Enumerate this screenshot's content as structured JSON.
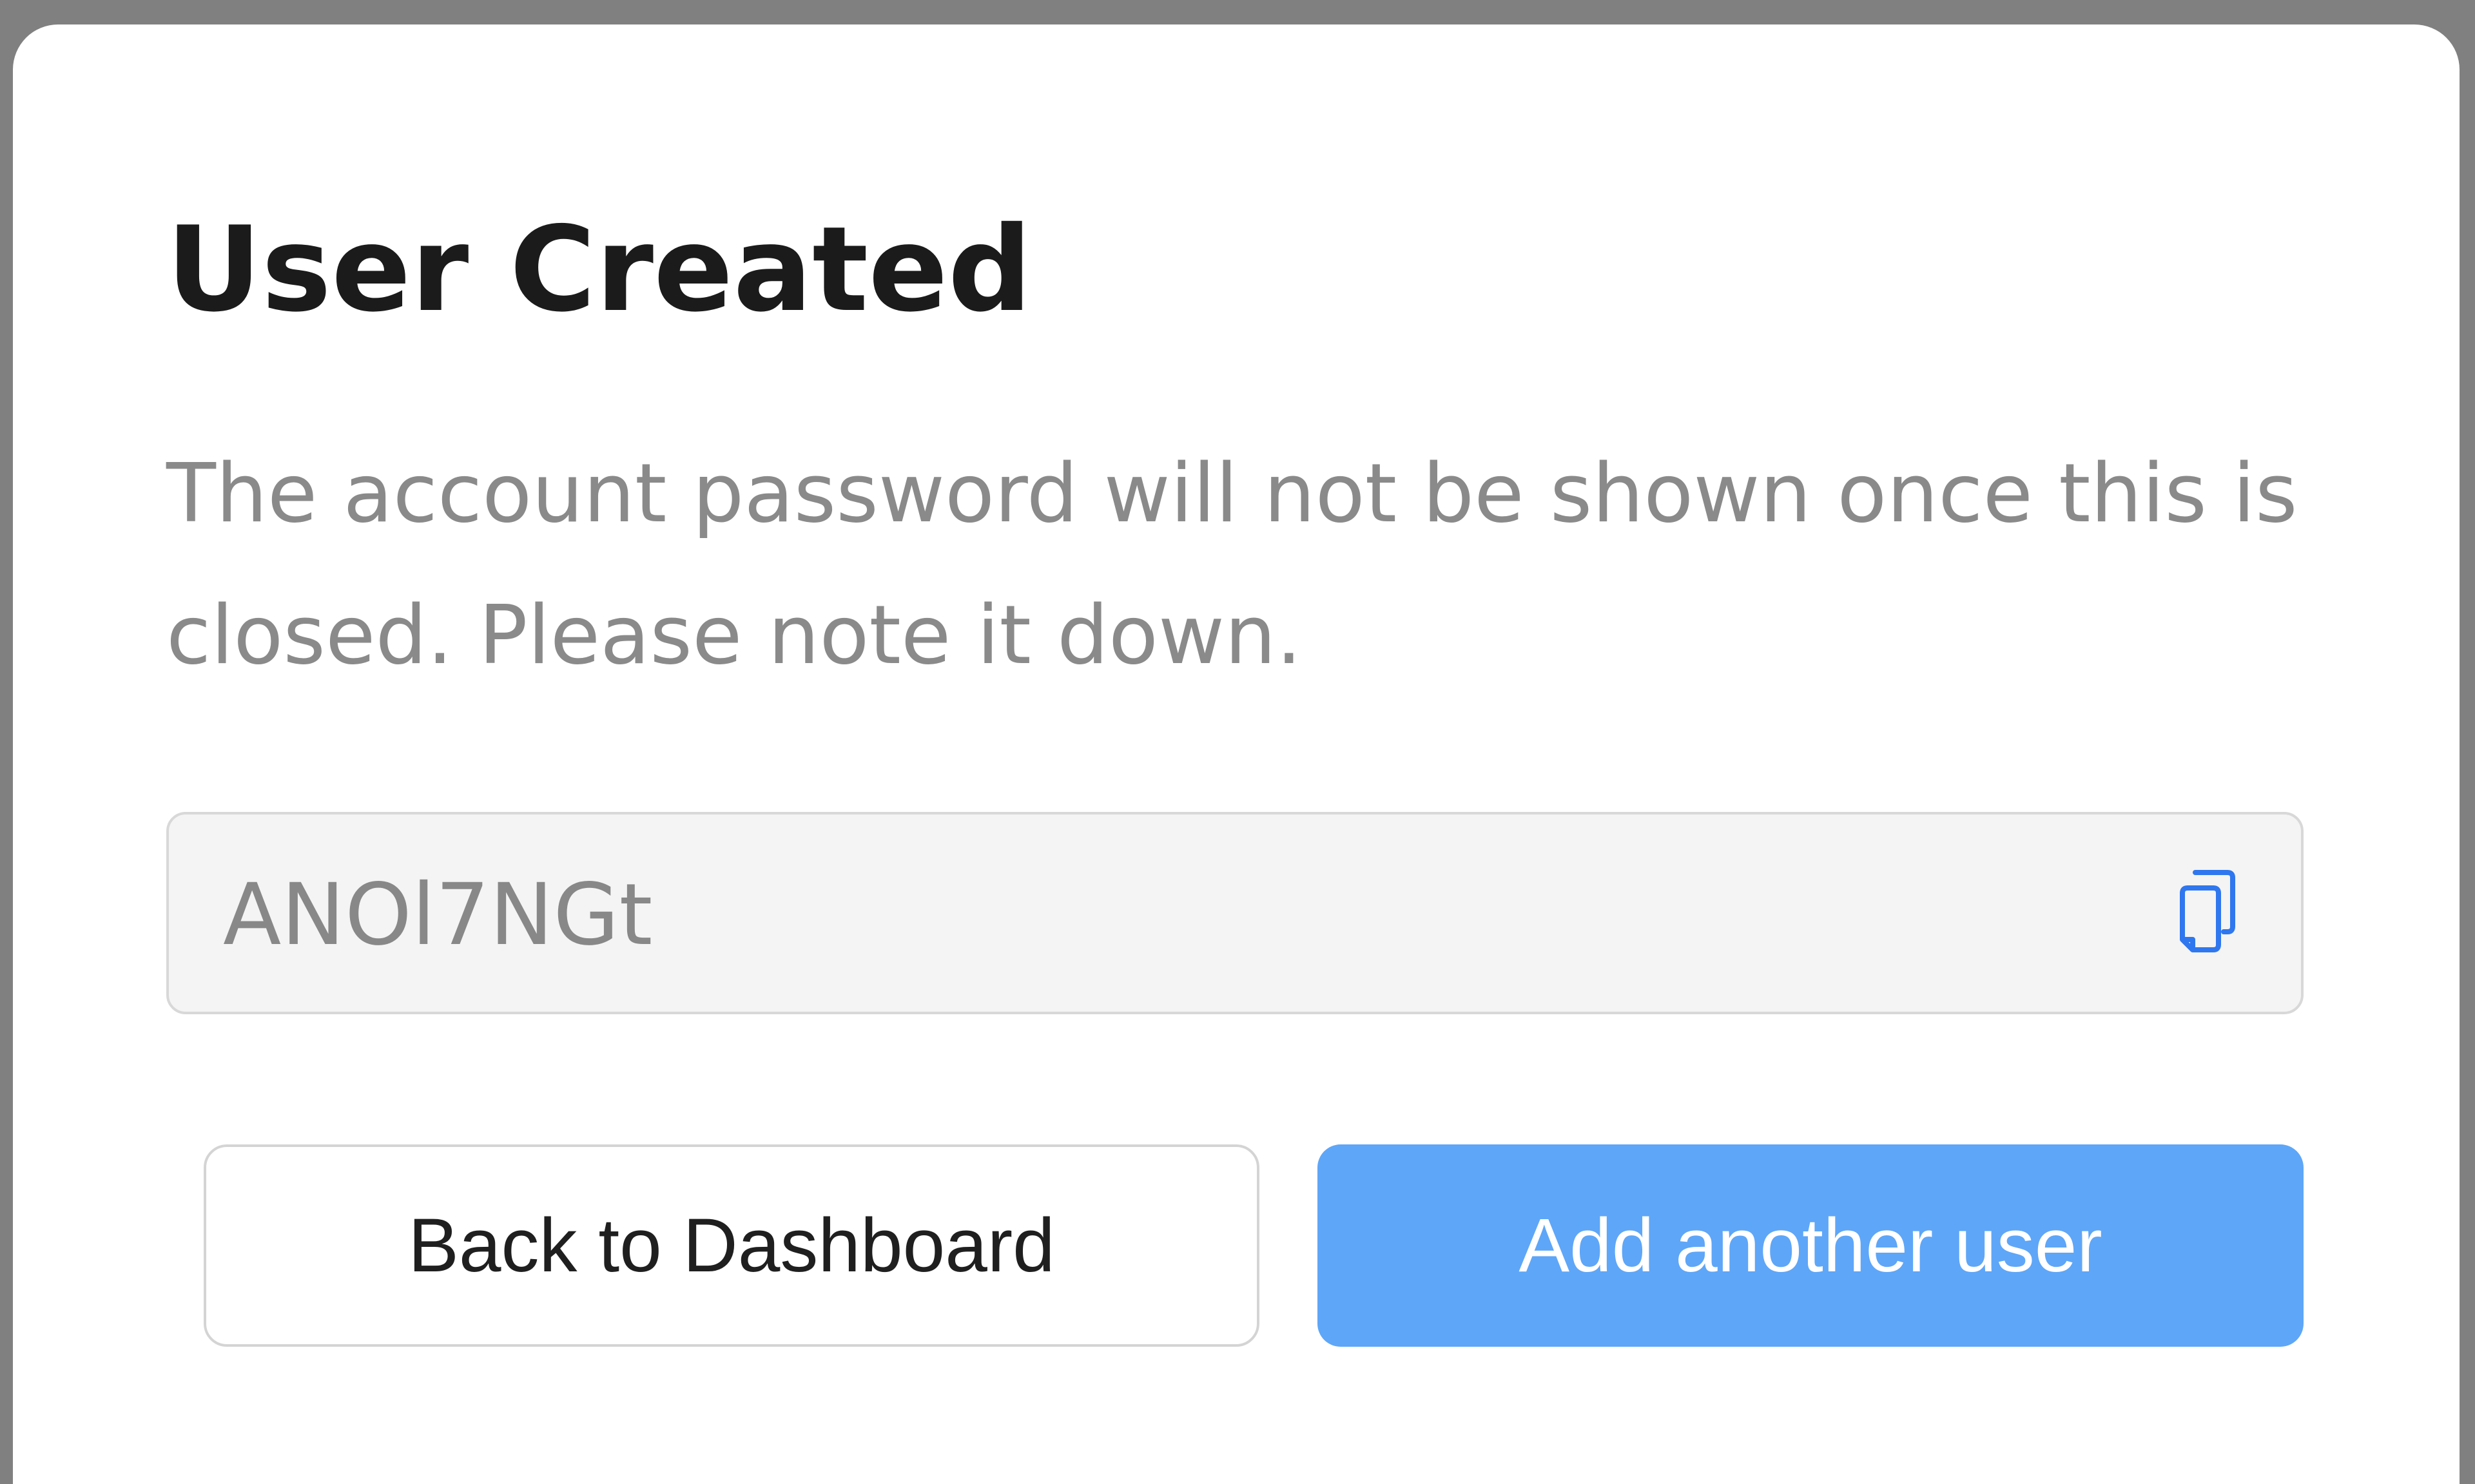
{
  "dialog": {
    "title": "User Created",
    "description": "The account password will not be shown once this is closed. Please note it down.",
    "password": "ANOl7NGt",
    "copy_icon": "copy-icon",
    "actions": {
      "back_label": "Back to Dashboard",
      "add_label": "Add another user"
    },
    "colors": {
      "backdrop": "#808080",
      "dialog_background": "#ffffff",
      "field_background": "#f4f4f4",
      "accent": "#5ea6f8",
      "icon": "#2f77ee"
    }
  }
}
